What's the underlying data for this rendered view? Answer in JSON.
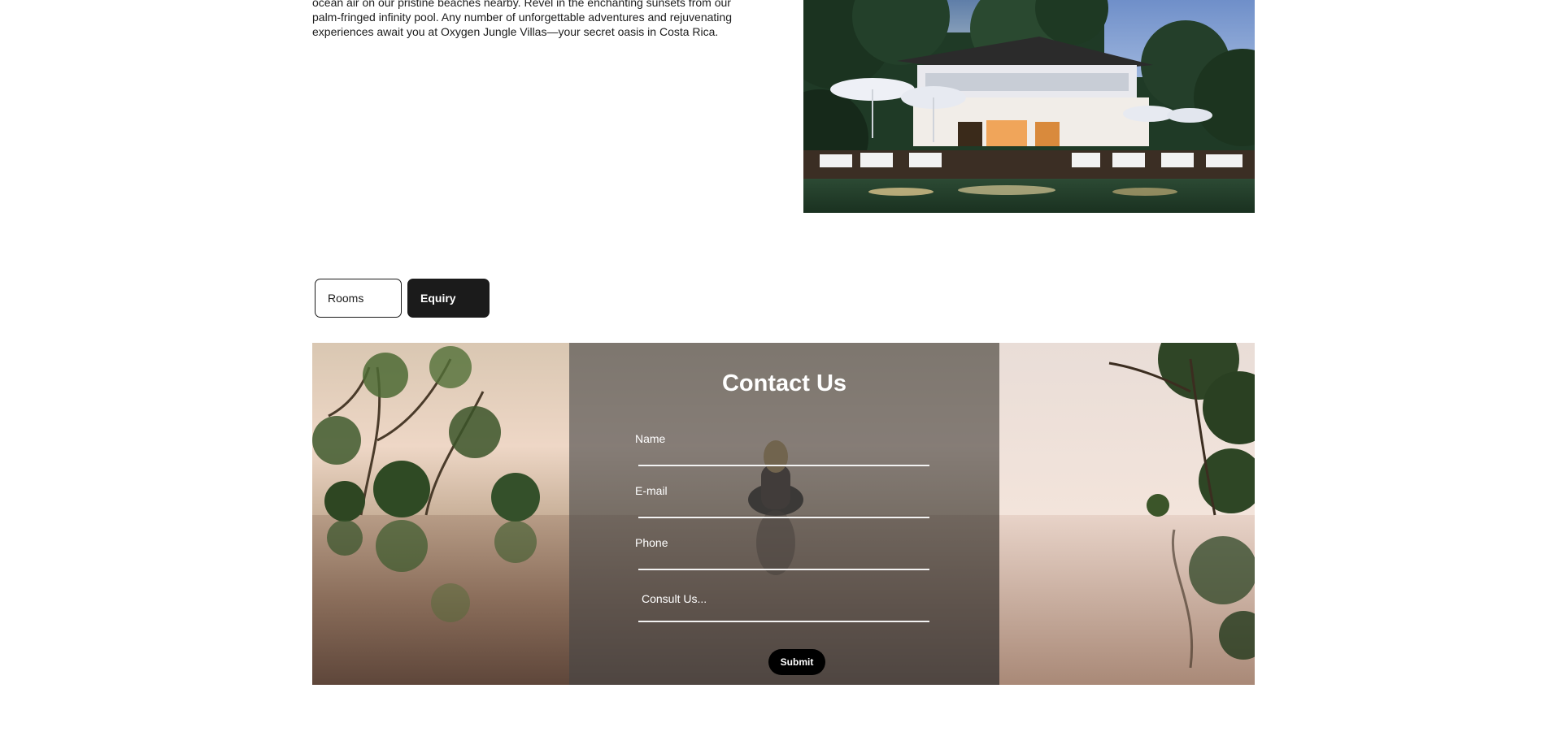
{
  "intro": {
    "lines": [
      "ocean air on our pristine beaches nearby. Revel in the enchanting sunsets from our",
      "palm-fringed infinity pool. Any number of unforgettable adventures and rejuvenating",
      "experiences await you at Oxygen Jungle Villas—your secret oasis in Costa Rica."
    ]
  },
  "tabs": {
    "rooms": "Rooms",
    "enquiry": "Equiry"
  },
  "contact": {
    "title": "Contact Us",
    "fields": {
      "name": "Name",
      "email": "E-mail",
      "phone": "Phone",
      "consult_placeholder": "Consult Us..."
    },
    "submit": "Submit"
  }
}
